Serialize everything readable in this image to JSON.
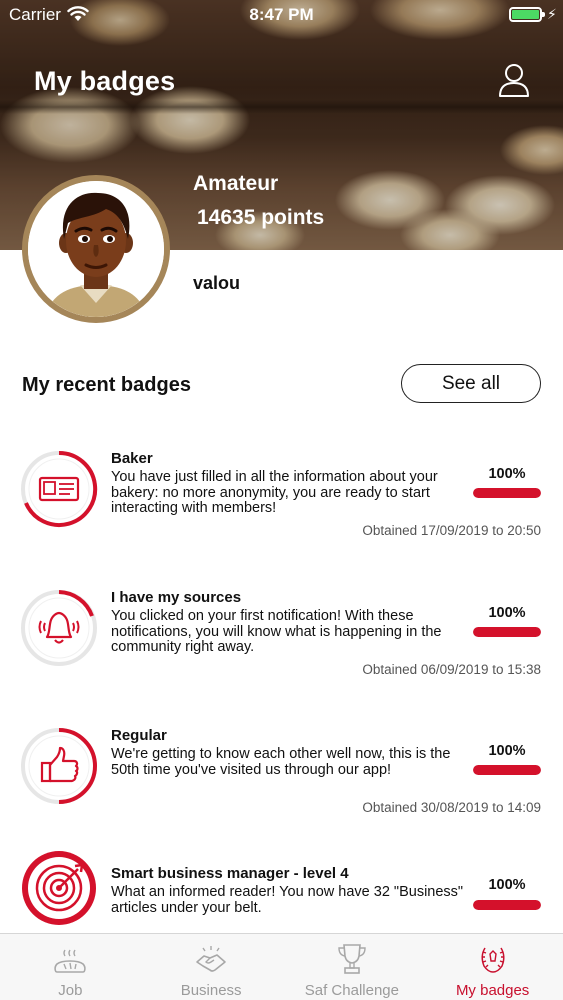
{
  "status_bar": {
    "carrier": "Carrier",
    "time": "8:47 PM"
  },
  "header": {
    "title": "My badges",
    "profile_icon": "user-icon"
  },
  "profile": {
    "level": "Amateur",
    "points": "14635 points",
    "username": "valou"
  },
  "recent": {
    "title": "My recent badges",
    "see_all_label": "See all"
  },
  "badges": [
    {
      "name": "Baker",
      "description": "You have just filled in all the information about your bakery: no more anonymity, you are ready to start interacting with members!",
      "progress_label": "100%",
      "progress": 1.0,
      "date": "Obtained 17/09/2019 to 20:50",
      "icon": "id-card-icon"
    },
    {
      "name": "I have my sources",
      "description": "You clicked on your first notification! With these notifications, you will know what is happening in the community right away.",
      "progress_label": "100%",
      "progress": 1.0,
      "date": "Obtained 06/09/2019 to 15:38",
      "icon": "bell-icon"
    },
    {
      "name": "Regular",
      "description": "We're getting to know each other well now, this is the 50th time you've visited us through our app!",
      "progress_label": "100%",
      "progress": 1.0,
      "date": "Obtained 30/08/2019 to 14:09",
      "icon": "thumbs-up-icon"
    },
    {
      "name": "Smart business manager - level 4",
      "description": "What an informed reader! You now have 32 \"Business\" articles under your belt.",
      "progress_label": "100%",
      "progress": 1.0,
      "date": "",
      "icon": "target-icon"
    }
  ],
  "tabs": [
    {
      "label": "Job",
      "icon": "bread-icon",
      "active": false
    },
    {
      "label": "Business",
      "icon": "handshake-icon",
      "active": false
    },
    {
      "label": "Saf Challenge",
      "icon": "trophy-icon",
      "active": false
    },
    {
      "label": "My badges",
      "icon": "laurel-badge-icon",
      "active": true
    }
  ],
  "colors": {
    "accent": "#c8102e",
    "progress": "#d4112b",
    "avatar_ring": "#a58659"
  }
}
